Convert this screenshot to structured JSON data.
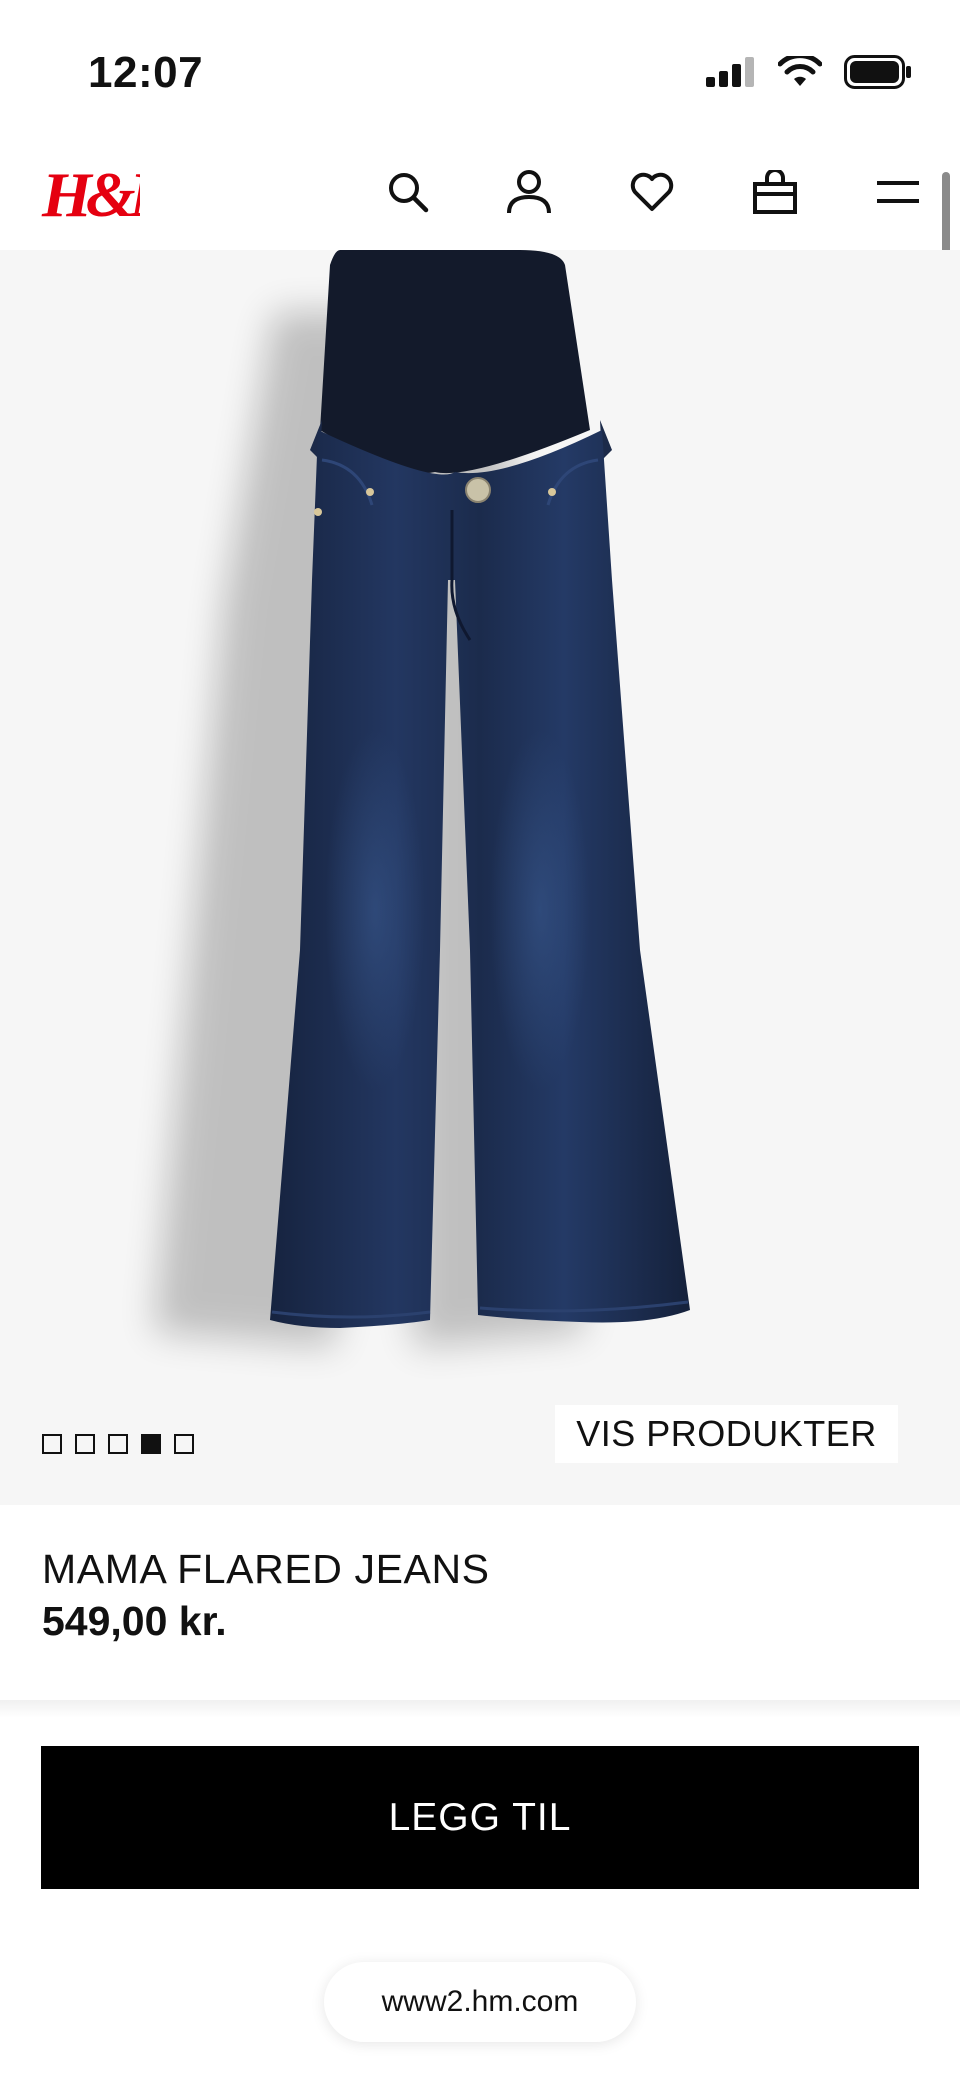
{
  "status_bar": {
    "time": "12:07"
  },
  "header": {
    "logo_text": "H&M",
    "brand_color": "#e50010",
    "icons": [
      "search-icon",
      "account-icon",
      "heart-icon",
      "bag-icon",
      "menu-icon"
    ]
  },
  "gallery": {
    "image_count": 5,
    "active_index": 3,
    "show_products_label": "VIS PRODUKTER"
  },
  "product": {
    "name": "MAMA FLARED JEANS",
    "price": "549,00 kr."
  },
  "cta": {
    "add_label": "LEGG TIL"
  },
  "browser": {
    "url": "www2.hm.com"
  },
  "colors": {
    "background": "#ffffff",
    "image_background": "#f6f6f6",
    "button": "#000000",
    "denim": "#1d2d4d",
    "waistband": "#131a2b"
  }
}
